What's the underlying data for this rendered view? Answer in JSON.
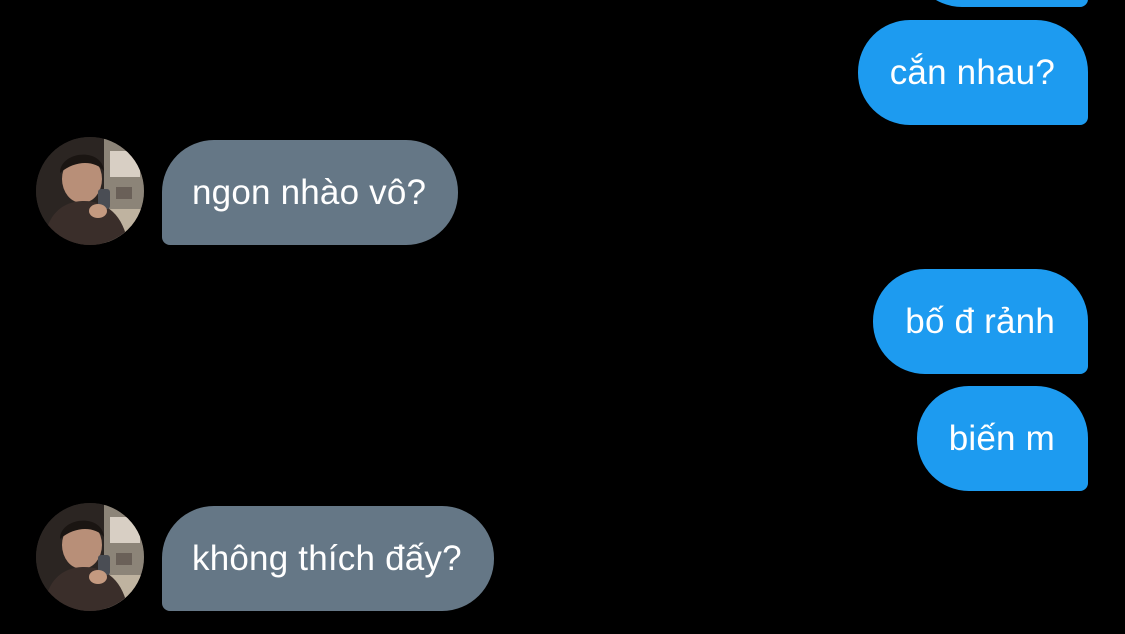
{
  "messages": [
    {
      "direction": "outgoing",
      "text": "cắn nhau?"
    },
    {
      "direction": "incoming",
      "text": "ngon nhào vô?"
    },
    {
      "direction": "outgoing",
      "text": "bố đ rảnh"
    },
    {
      "direction": "outgoing",
      "text": "biến m"
    },
    {
      "direction": "incoming",
      "text": "không thích đấy?"
    }
  ],
  "avatar": {
    "icon": "user-photo-avatar"
  },
  "colors": {
    "background": "#000000",
    "outgoing_bubble": "#1d9bf0",
    "incoming_bubble": "#657786",
    "text": "#ffffff"
  }
}
